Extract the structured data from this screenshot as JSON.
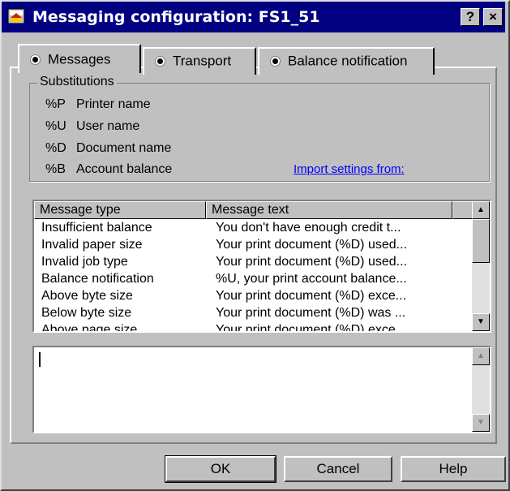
{
  "window": {
    "title": "Messaging configuration: FS1_51",
    "help_button": "?",
    "close_button": "×"
  },
  "tabs": [
    {
      "label": "Messages"
    },
    {
      "label": "Transport"
    },
    {
      "label": "Balance notification"
    }
  ],
  "substitutions": {
    "legend": "Substitutions",
    "items": [
      {
        "code": "%P",
        "label": "Printer name"
      },
      {
        "code": "%U",
        "label": "User name"
      },
      {
        "code": "%D",
        "label": "Document name"
      },
      {
        "code": "%B",
        "label": "Account balance"
      }
    ],
    "import_link": "Import settings from:"
  },
  "message_list": {
    "columns": [
      "Message type",
      "Message text"
    ],
    "rows": [
      {
        "type": "Insufficient balance",
        "text": "You don't have enough credit t..."
      },
      {
        "type": "Invalid paper size",
        "text": "Your print document (%D) used..."
      },
      {
        "type": "Invalid job type",
        "text": "Your print document (%D) used..."
      },
      {
        "type": "Balance notification",
        "text": "%U, your print account balance..."
      },
      {
        "type": "Above byte size",
        "text": "Your print document (%D) exce..."
      },
      {
        "type": "Below byte size",
        "text": "Your print document (%D) was ..."
      },
      {
        "type": "Above page size",
        "text": "Your print document (%D) exce..."
      }
    ]
  },
  "editor": {
    "value": ""
  },
  "buttons": {
    "ok": "OK",
    "cancel": "Cancel",
    "help": "Help"
  }
}
